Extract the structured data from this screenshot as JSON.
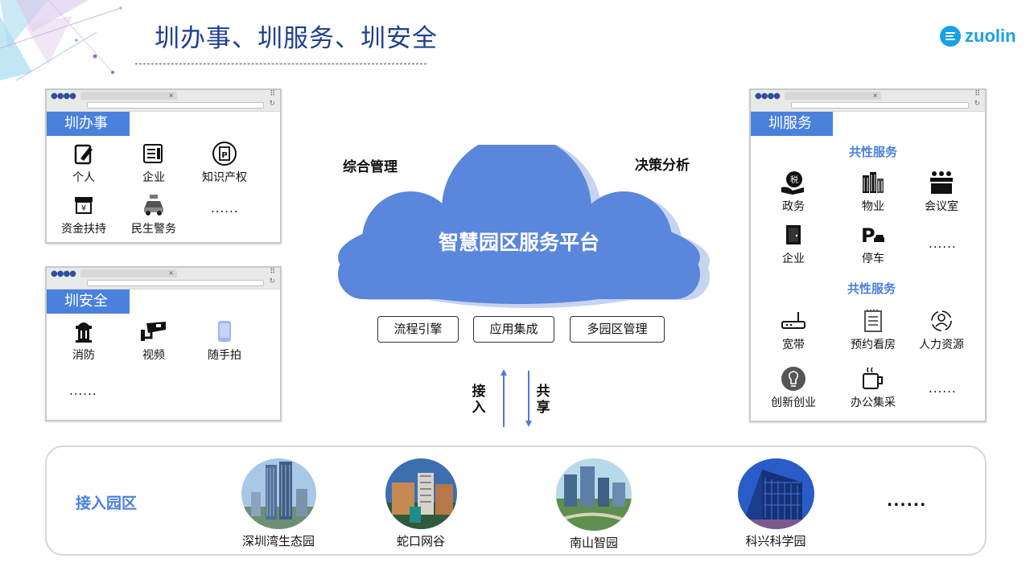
{
  "header": {
    "title": "圳办事、圳服务、圳安全",
    "brand": "zuolin"
  },
  "colors": {
    "accent": "#4a81dc",
    "title": "#1f3f8f",
    "brand": "#1aa0e8",
    "cloud": "#5a86dc"
  },
  "panel_zbs": {
    "tab": "圳办事",
    "items": [
      {
        "label": "个人",
        "icon": "pen-edit-icon"
      },
      {
        "label": "企业",
        "icon": "document-list-icon"
      },
      {
        "label": "知识产权",
        "icon": "patent-icon"
      },
      {
        "label": "资金扶持",
        "icon": "yen-fund-icon"
      },
      {
        "label": "民生警务",
        "icon": "police-car-icon"
      }
    ],
    "more": "......"
  },
  "panel_zaq": {
    "tab": "圳安全",
    "items": [
      {
        "label": "消防",
        "icon": "fire-hydrant-icon"
      },
      {
        "label": "视频",
        "icon": "cctv-camera-icon"
      },
      {
        "label": "随手拍",
        "icon": "phone-icon"
      }
    ],
    "more": "......"
  },
  "panel_zfw": {
    "tab": "圳服务",
    "section1": "共性服务",
    "items1": [
      {
        "label": "政务",
        "icon": "gov-hand-icon"
      },
      {
        "label": "物业",
        "icon": "buildings-icon"
      },
      {
        "label": "会议室",
        "icon": "meeting-room-icon"
      },
      {
        "label": "企业",
        "icon": "door-icon"
      },
      {
        "label": "停车",
        "icon": "parking-icon"
      }
    ],
    "more1": "......",
    "section2": "共性服务",
    "items2": [
      {
        "label": "宽带",
        "icon": "router-icon"
      },
      {
        "label": "预约看房",
        "icon": "notepad-icon"
      },
      {
        "label": "人力资源",
        "icon": "person-cycle-icon"
      },
      {
        "label": "创新创业",
        "icon": "lightbulb-icon"
      },
      {
        "label": "办公集采",
        "icon": "coffee-cup-icon"
      }
    ],
    "more2": "......"
  },
  "center": {
    "left_label": "综合管理",
    "right_label": "决策分析",
    "platform": "智慧园区服务平台",
    "pills": [
      "流程引擎",
      "应用集成",
      "多园区管理"
    ],
    "up_label": "接入",
    "down_label": "共享"
  },
  "bottom": {
    "title": "接入园区",
    "parks": [
      "深圳湾生态园",
      "蛇口网谷",
      "南山智园",
      "科兴科学园"
    ],
    "more": "......"
  }
}
